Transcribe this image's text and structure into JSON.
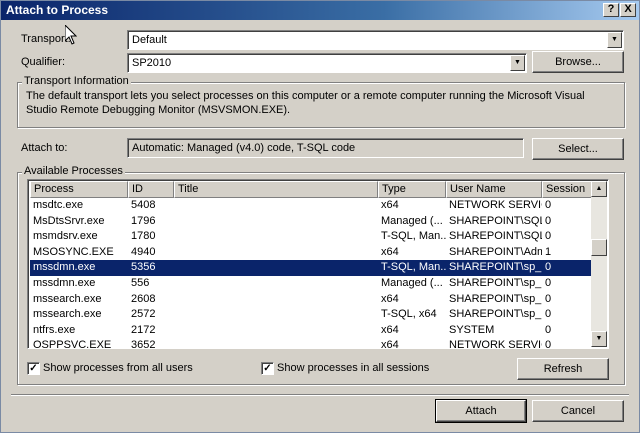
{
  "window": {
    "title": "Attach to Process",
    "help_glyph": "?",
    "close_glyph": "X"
  },
  "transport": {
    "label": "Transport:",
    "value": "Default"
  },
  "qualifier": {
    "label": "Qualifier:",
    "value": "SP2010",
    "browse_label": "Browse..."
  },
  "transport_info": {
    "title": "Transport Information",
    "text": "The default transport lets you select processes on this computer or a remote computer running the Microsoft Visual Studio Remote Debugging Monitor (MSVSMON.EXE)."
  },
  "attach_to": {
    "label": "Attach to:",
    "value": "Automatic: Managed (v4.0) code, T-SQL code",
    "select_label": "Select..."
  },
  "available": {
    "title": "Available Processes",
    "columns": [
      "Process",
      "ID",
      "Title",
      "Type",
      "User Name",
      "Session"
    ],
    "rows": [
      [
        "msdtc.exe",
        "5408",
        "",
        "x64",
        "NETWORK SERVICE",
        "0"
      ],
      [
        "MsDtsSrvr.exe",
        "1796",
        "",
        "Managed (...",
        "SHAREPOINT\\SQL...",
        "0"
      ],
      [
        "msmdsrv.exe",
        "1780",
        "",
        "T-SQL, Man...",
        "SHAREPOINT\\SQL...",
        "0"
      ],
      [
        "MSOSYNC.EXE",
        "4940",
        "",
        "x64",
        "SHAREPOINT\\Adm...",
        "1"
      ],
      [
        "mssdmn.exe",
        "5356",
        "",
        "T-SQL, Man...",
        "SHAREPOINT\\sp_...",
        "0"
      ],
      [
        "mssdmn.exe",
        "556",
        "",
        "Managed (...",
        "SHAREPOINT\\sp_...",
        "0"
      ],
      [
        "mssearch.exe",
        "2608",
        "",
        "x64",
        "SHAREPOINT\\sp_...",
        "0"
      ],
      [
        "mssearch.exe",
        "2572",
        "",
        "T-SQL, x64",
        "SHAREPOINT\\sp_...",
        "0"
      ],
      [
        "ntfrs.exe",
        "2172",
        "",
        "x64",
        "SYSTEM",
        "0"
      ],
      [
        "OSPPSVC.EXE",
        "3652",
        "",
        "x64",
        "NETWORK SERVICE",
        "0"
      ]
    ],
    "selected_row": 4,
    "show_all_users_label": "Show processes from all users",
    "show_all_users": true,
    "show_all_sessions_label": "Show processes in all sessions",
    "show_all_sessions": true,
    "refresh_label": "Refresh"
  },
  "footer": {
    "attach_label": "Attach",
    "cancel_label": "Cancel"
  },
  "colors": {
    "selection": "#0a246a",
    "title_bar": "#0a246a",
    "dialog_bg": "#d4d0c8"
  }
}
